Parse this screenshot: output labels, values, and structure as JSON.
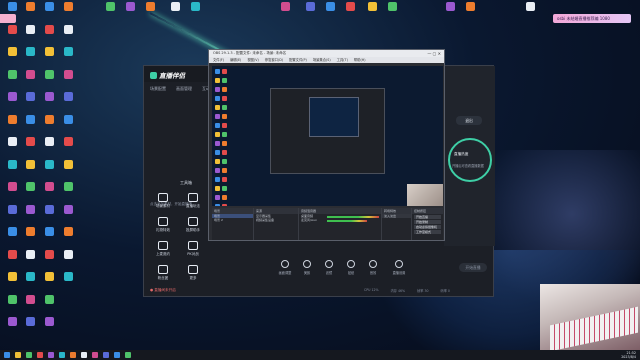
{
  "desktop": {
    "top_badge": "osbi 未结婚直播推荐编 1080",
    "icons_row1": [
      "",
      "",
      "",
      "",
      "",
      "",
      "",
      ""
    ],
    "left_column_labels": [
      "",
      "",
      "",
      "",
      "",
      "",
      "",
      "",
      "",
      "",
      "",
      "",
      "",
      "",
      "",
      "",
      "",
      "",
      "",
      "",
      "",
      "",
      "",
      "",
      ""
    ],
    "colors": {
      "bg_top": "#1b3a5a",
      "bg_bottom": "#050a18",
      "streak": "#6fffd0"
    }
  },
  "app": {
    "logo": "直播伴侣",
    "nav": [
      "场景配置",
      "画面管理",
      "互动玩法"
    ],
    "left_hint": "点击添加素材，开始直播吧",
    "tools_title": "工具箱",
    "tools": [
      {
        "label": "场景素材",
        "icon": "scene-icon"
      },
      {
        "label": "直播玩法",
        "icon": "play-icon"
      },
      {
        "label": "礼物特效",
        "icon": "gift-icon"
      },
      {
        "label": "投屏助手",
        "icon": "cast-icon"
      },
      {
        "label": "上麦邀约",
        "icon": "mic-icon"
      },
      {
        "label": "PK对战",
        "icon": "pk-icon"
      },
      {
        "label": "粉丝团",
        "icon": "fans-icon"
      },
      {
        "label": "更多",
        "icon": "more-icon"
      }
    ],
    "bottom_controls": [
      "画面调整",
      "美颜",
      "滤镜",
      "贴纸",
      "音效",
      "直播设置"
    ],
    "start_button": "开始直播",
    "status_warning": "直播间未开启",
    "status_right": [
      "CPU 12%",
      "内存 46%",
      "帧率 30",
      "码率 0"
    ],
    "right_panel": {
      "button": "退出",
      "circle_label": "直播热度",
      "text": "开播后可查看直播数据"
    },
    "accent": "#3ecfa6"
  },
  "obs": {
    "title": "OBS 29.1.3 - 配置文件: 未命名 - 场景: 未命名",
    "menu": [
      "文件(F)",
      "编辑(E)",
      "视图(V)",
      "停靠窗口(D)",
      "配置文件(P)",
      "场景集合(S)",
      "工具(T)",
      "帮助(H)"
    ],
    "docks": {
      "scenes_title": "场景",
      "scenes": [
        "场景",
        "场景 2"
      ],
      "sources_title": "来源",
      "sources": [
        "显示器采集",
        "视频采集设备"
      ],
      "mixer_title": "音频混音器",
      "mixer": [
        "桌面音频",
        "麦克风/Aux"
      ],
      "transitions_title": "转场特效",
      "transition_value": "淡入淡出",
      "controls_title": "控制按钮",
      "controls": [
        "开始直播",
        "开始录制",
        "启动虚拟摄像机",
        "工作室模式",
        "设置",
        "退出"
      ]
    }
  },
  "taskbar": {
    "clock_time": "21:52",
    "clock_date": "2023/8/4"
  }
}
